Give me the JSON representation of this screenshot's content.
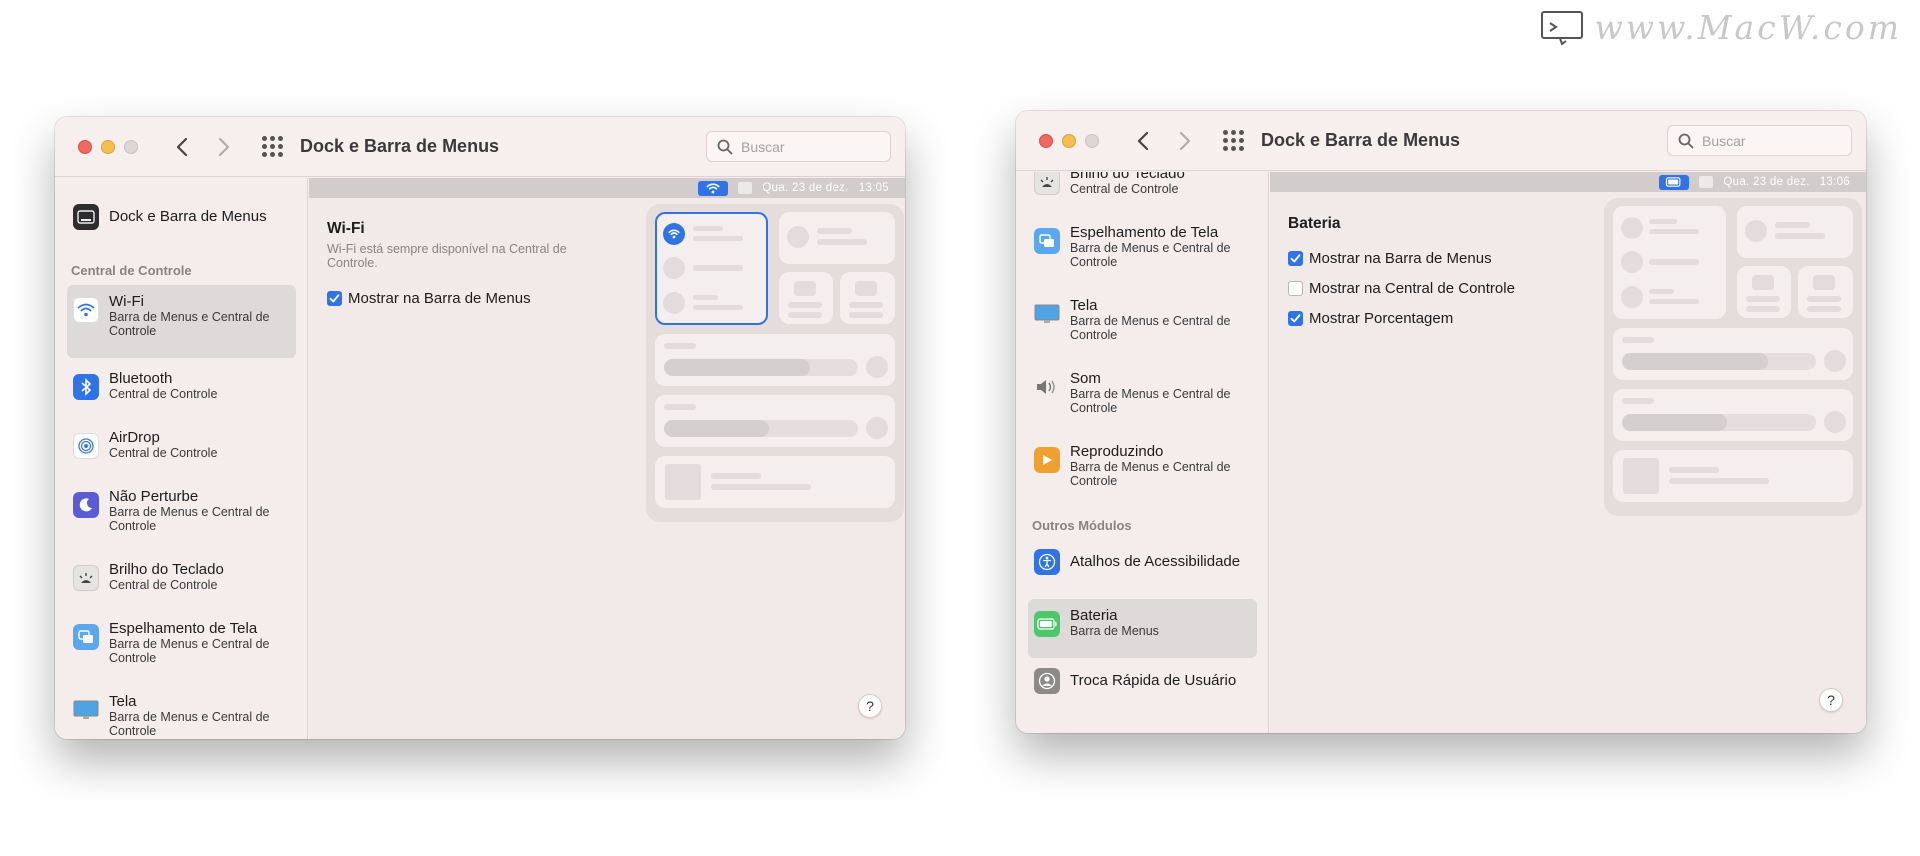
{
  "watermark": {
    "text": "www.MacW.com"
  },
  "window1": {
    "title": "Dock e Barra de Menus",
    "search_placeholder": "Buscar",
    "menubar": {
      "date": "Qua. 23 de dez.",
      "time": "13:05"
    },
    "sidebar": {
      "top_item": {
        "title": "Dock e Barra de Menus"
      },
      "section_label": "Central de Controle",
      "items": [
        {
          "title": "Wi-Fi",
          "sub1": "Barra de Menus e Central de",
          "sub2": "Controle",
          "icon": "wifi-icon",
          "selected": true
        },
        {
          "title": "Bluetooth",
          "sub1": "Central de Controle",
          "sub2": "",
          "icon": "bluetooth-icon"
        },
        {
          "title": "AirDrop",
          "sub1": "Central de Controle",
          "sub2": "",
          "icon": "airdrop-icon"
        },
        {
          "title": "Não Perturbe",
          "sub1": "Barra de Menus e Central de",
          "sub2": "Controle",
          "icon": "moon-icon"
        },
        {
          "title": "Brilho do Teclado",
          "sub1": "Central de Controle",
          "sub2": "",
          "icon": "keyboard-brightness-icon"
        },
        {
          "title": "Espelhamento de Tela",
          "sub1": "Barra de Menus e Central de",
          "sub2": "Controle",
          "icon": "screen-mirroring-icon"
        },
        {
          "title": "Tela",
          "sub1": "Barra de Menus e Central de",
          "sub2": "Controle",
          "icon": "display-icon"
        }
      ]
    },
    "content": {
      "title": "Wi-Fi",
      "desc": "Wi-Fi está sempre disponível na Central de Controle.",
      "options": [
        {
          "label": "Mostrar na Barra de Menus",
          "checked": true
        }
      ]
    },
    "help": "?"
  },
  "window2": {
    "title": "Dock e Barra de Menus",
    "search_placeholder": "Buscar",
    "menubar": {
      "date": "Qua. 23 de dez.",
      "time": "13:06"
    },
    "sidebar": {
      "items": [
        {
          "title": "Brilho do Teclado",
          "sub1": "Central de Controle",
          "sub2": "",
          "icon": "keyboard-brightness-icon"
        },
        {
          "title": "Espelhamento de Tela",
          "sub1": "Barra de Menus e Central de",
          "sub2": "Controle",
          "icon": "screen-mirroring-icon"
        },
        {
          "title": "Tela",
          "sub1": "Barra de Menus e Central de",
          "sub2": "Controle",
          "icon": "display-icon"
        },
        {
          "title": "Som",
          "sub1": "Barra de Menus e Central de",
          "sub2": "Controle",
          "icon": "sound-icon"
        },
        {
          "title": "Reproduzindo",
          "sub1": "Barra de Menus e Central de",
          "sub2": "Controle",
          "icon": "now-playing-icon"
        }
      ],
      "section_label": "Outros Módulos",
      "other_items": [
        {
          "title": "Atalhos de Acessibilidade",
          "sub1": "",
          "icon": "accessibility-icon"
        },
        {
          "title": "Bateria",
          "sub1": "Barra de Menus",
          "icon": "battery-icon",
          "selected": true
        },
        {
          "title": "Troca Rápida de Usuário",
          "sub1": "",
          "icon": "user-switch-icon"
        }
      ]
    },
    "content": {
      "title": "Bateria",
      "options": [
        {
          "label": "Mostrar na Barra de Menus",
          "checked": true
        },
        {
          "label": "Mostrar na Central de Controle",
          "checked": false
        },
        {
          "label": "Mostrar Porcentagem",
          "checked": true
        }
      ]
    },
    "help": "?"
  },
  "colors": {
    "accent": "#2f73e5",
    "window_bg": "#f6eded",
    "selection": "#dedad9"
  }
}
